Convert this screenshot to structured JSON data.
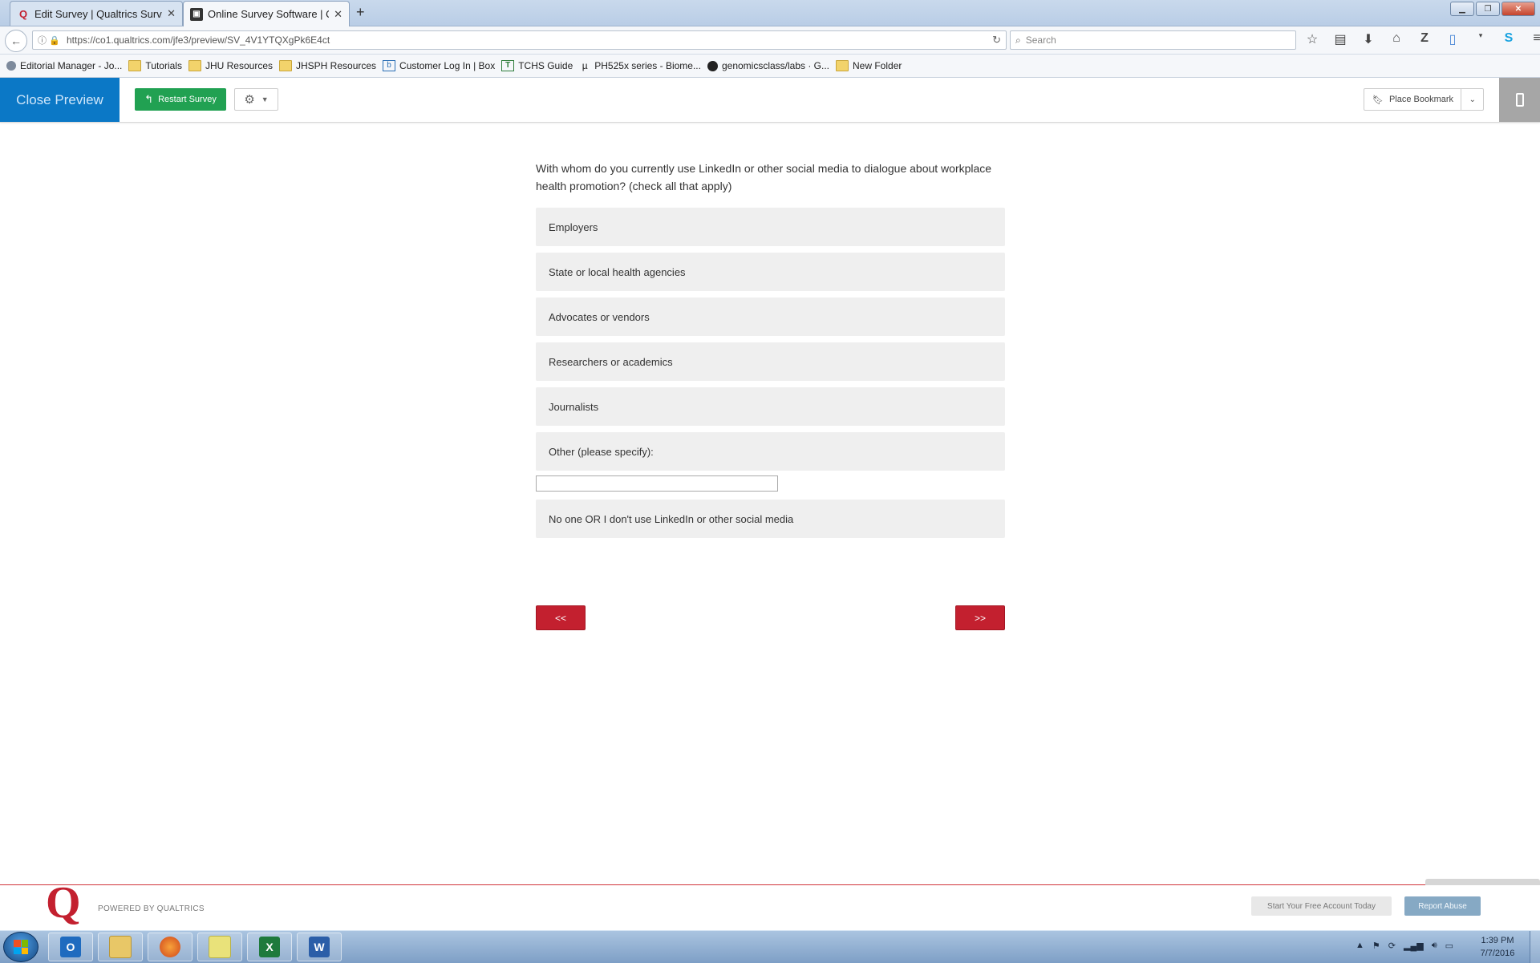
{
  "browser": {
    "tabs": [
      {
        "title": "Edit Survey | Qualtrics Surv...",
        "active": false
      },
      {
        "title": "Online Survey Software | Q...",
        "active": true
      }
    ],
    "new_tab_label": "+",
    "url": "https://co1.qualtrics.com/jfe3/preview/SV_4V1YTQXgPk6E4ct",
    "search_placeholder": "Search",
    "bookmarks": [
      {
        "label": "Editorial Manager - Jo...",
        "icon": "editorial-icon"
      },
      {
        "label": "Tutorials",
        "icon": "folder-icon"
      },
      {
        "label": "JHU Resources",
        "icon": "folder-icon"
      },
      {
        "label": "JHSPH Resources",
        "icon": "folder-icon"
      },
      {
        "label": "Customer Log In | Box",
        "icon": "box-icon"
      },
      {
        "label": "TCHS Guide",
        "icon": "tchs-icon"
      },
      {
        "label": "PH525x series - Biome...",
        "icon": "mu-icon"
      },
      {
        "label": "genomicsclass/labs · G...",
        "icon": "github-icon"
      },
      {
        "label": "New Folder",
        "icon": "folder-icon"
      }
    ]
  },
  "toolbar": {
    "close_preview": "Close Preview",
    "restart_survey": "Restart Survey",
    "place_bookmark": "Place Bookmark"
  },
  "survey": {
    "question": "With whom do you currently use LinkedIn or other social media to dialogue about workplace health promotion? (check all that apply)",
    "choices": [
      "Employers",
      "State or local health agencies",
      "Advocates or vendors",
      "Researchers or academics",
      "Journalists",
      "Other (please specify):",
      "No one OR I don't use LinkedIn or other social media"
    ],
    "other_value": "",
    "back_label": "<<",
    "next_label": ">>"
  },
  "footer": {
    "logo": "Q",
    "powered_by": "POWERED BY QUALTRICS",
    "free_account": "Start Your Free Account Today",
    "report_abuse": "Report Abuse"
  },
  "taskbar": {
    "apps": [
      "outlook",
      "file-explorer",
      "firefox",
      "sticky-notes",
      "excel",
      "word"
    ],
    "time": "1:39 PM",
    "date": "7/7/2016"
  },
  "colors": {
    "close_preview_bg": "#0b78c6",
    "restart_bg": "#21a152",
    "nav_button": "#c3202f",
    "choice_bg": "#efefef"
  }
}
